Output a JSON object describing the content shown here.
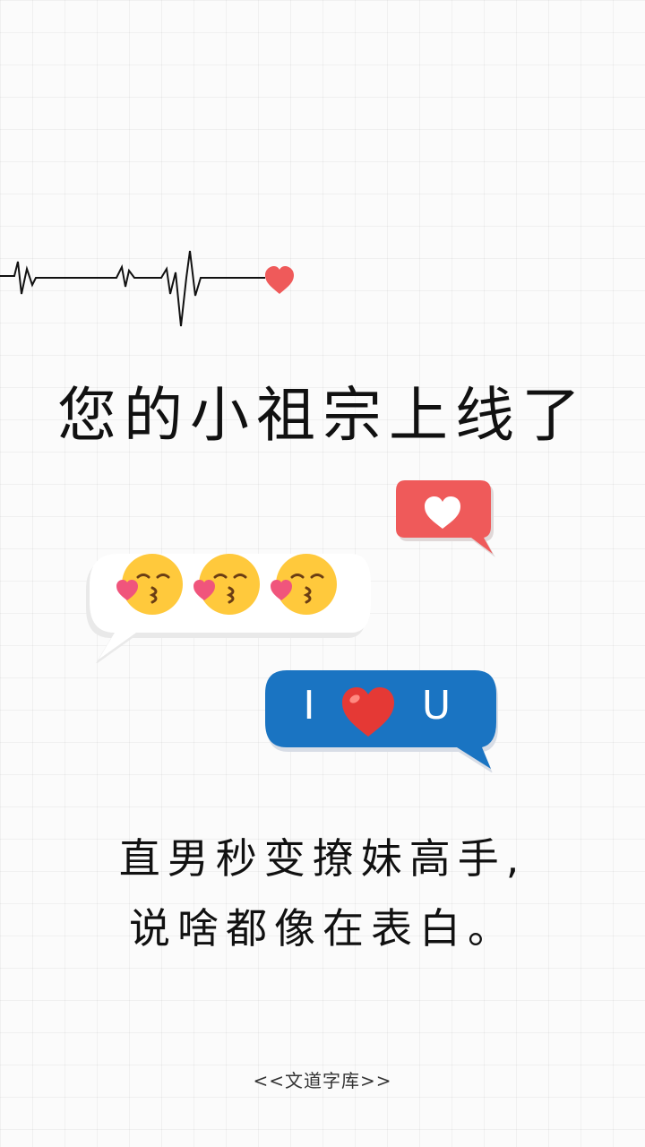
{
  "title": "您的小祖宗上线了",
  "bubbles": {
    "emoji_count": 3,
    "iu": {
      "left": "I",
      "right": "U"
    }
  },
  "body": {
    "line1": "直男秒变撩妹高手,",
    "line2": "说啥都像在表白。"
  },
  "footer": "<<文道字库>>",
  "colors": {
    "like_bubble": "#ef5a5a",
    "iu_bubble": "#1a74c2",
    "heart": "#e53935",
    "emoji_face": "#ffc93c"
  }
}
